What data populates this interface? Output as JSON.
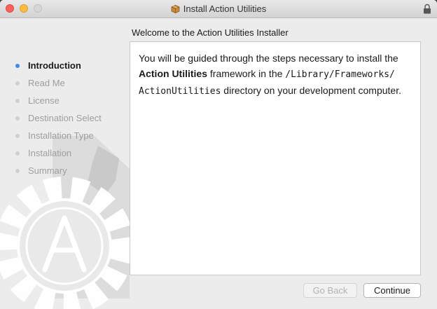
{
  "window": {
    "title": "Install Action Utilities"
  },
  "sidebar": {
    "steps": [
      {
        "label": "Introduction",
        "active": true
      },
      {
        "label": "Read Me",
        "active": false
      },
      {
        "label": "License",
        "active": false
      },
      {
        "label": "Destination Select",
        "active": false
      },
      {
        "label": "Installation Type",
        "active": false
      },
      {
        "label": "Installation",
        "active": false
      },
      {
        "label": "Summary",
        "active": false
      }
    ]
  },
  "main": {
    "heading": "Welcome to the Action Utilities Installer",
    "body": {
      "part1": "You will be guided through the steps necessary to install the ",
      "strong": "Action Utilities",
      "part2": " framework in the ",
      "path1": "/Library/Frameworks/",
      "path2": "ActionUtilities",
      "part3": " directory on your development computer."
    }
  },
  "buttons": {
    "back_label": "Go Back",
    "continue_label": "Continue"
  },
  "icons": {
    "window_icon": "package-icon",
    "lock": "lock-icon",
    "background_art": "gear-wrench-logo-icon"
  },
  "colors": {
    "active_step_dot": "#3d8ce8",
    "close": "#fc605c",
    "minimize": "#fdbc40"
  }
}
